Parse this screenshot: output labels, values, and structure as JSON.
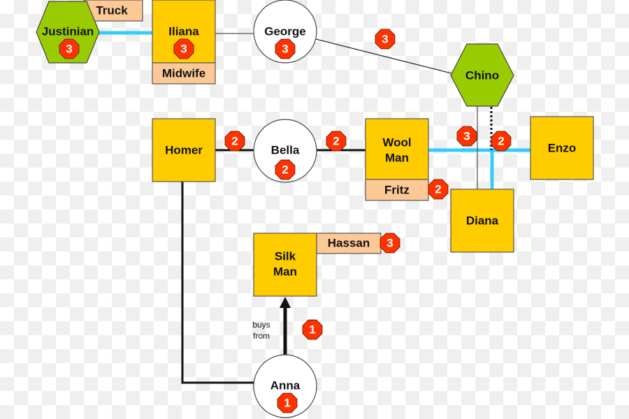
{
  "colors": {
    "person": "#ffcc00",
    "role": "#fcc896",
    "hexagon": "#99cc00",
    "badge": "#ff3300",
    "cyan_link": "#33ccff"
  },
  "nodes": {
    "justinian": {
      "label": "Justinian",
      "shape": "hexagon",
      "badge": "3",
      "role": "Truck"
    },
    "iliana": {
      "label": "Iliana",
      "shape": "square",
      "badge": "3",
      "role": "Midwife"
    },
    "george": {
      "label": "George",
      "shape": "circle",
      "badge": "3"
    },
    "chino": {
      "label": "Chino",
      "shape": "hexagon"
    },
    "homer": {
      "label": "Homer",
      "shape": "square"
    },
    "bella": {
      "label": "Bella",
      "shape": "circle",
      "badge": "2"
    },
    "woolman": {
      "label_line1": "Wool",
      "label_line2": "Man",
      "shape": "square",
      "role": "Fritz",
      "role_badge": "2"
    },
    "enzo": {
      "label": "Enzo",
      "shape": "square"
    },
    "diana": {
      "label": "Diana",
      "shape": "square"
    },
    "silkman": {
      "label_line1": "Silk",
      "label_line2": "Man",
      "shape": "square",
      "role": "Hassan",
      "role_badge": "3"
    },
    "anna": {
      "label": "Anna",
      "shape": "circle",
      "badge": "1"
    }
  },
  "edges": {
    "george_chino_badge": "3",
    "homer_bella_badge": "2",
    "bella_woolman_badge": "2",
    "chino_diana_badge": "3",
    "chino_enzo_badge": "2",
    "anna_silkman": {
      "label_line1": "buys",
      "label_line2": "from",
      "badge": "1"
    }
  }
}
